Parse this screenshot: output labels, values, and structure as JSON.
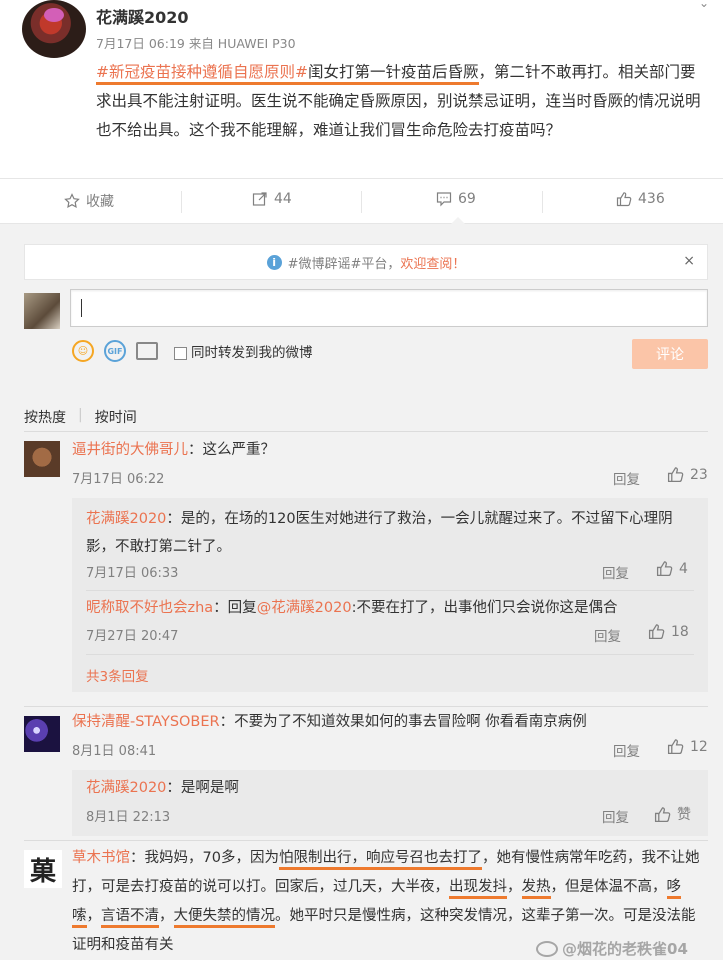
{
  "post": {
    "author": "花满蹊2020",
    "meta": "7月17日 06:19 来自 HUAWEI P30",
    "hashtag": "#新冠疫苗接种遵循自愿原则#",
    "text_underlined": "闺女打第一针疫苗后昏厥",
    "text_rest_1": "，第二针不敢再打。相关部门要求出具不能注射证明。医生说不能确定昏厥原因，别说禁忌证明，连当时昏厥的情况说明也不给出具。这个我不能理解，难道让我们冒生命危险去打疫苗吗？"
  },
  "actions": {
    "favorite": "收藏",
    "forward": "44",
    "comment": "69",
    "like": "436"
  },
  "notice": {
    "hashtag": "#微博辟谣#平台，",
    "welcome": "欢迎查阅！",
    "close": "×"
  },
  "composer": {
    "also_forward": "同时转发到我的微博",
    "submit": "评论",
    "gif": "GIF"
  },
  "sort": {
    "hot": "按热度",
    "time": "按时间"
  },
  "comments": [
    {
      "name": "逼井街的大佛哥儿",
      "text": "：这么严重？",
      "time": "7月17日 06:22",
      "reply": "回复",
      "likes": "23",
      "subreplies": [
        {
          "name": "花满蹊2020",
          "text": "：是的，在场的120医生对她进行了救治，一会儿就醒过来了。不过留下心理阴影，不敢打第二针了。",
          "time": "7月17日 06:33",
          "reply": "回复",
          "likes": "4"
        },
        {
          "name": "昵称取不好也会zha",
          "text_pre": "：回复",
          "mention": "@花满蹊2020",
          "text": ":不要在打了，出事他们只会说你这是偶合",
          "time": "7月27日 20:47",
          "reply": "回复",
          "likes": "18"
        }
      ],
      "more": "共3条回复"
    },
    {
      "name": "保持清醒-STAYSOBER",
      "text": "：不要为了不知道效果如何的事去冒险啊 你看看南京病例",
      "time": "8月1日 08:41",
      "reply": "回复",
      "likes": "12",
      "subreplies": [
        {
          "name": "花满蹊2020",
          "text": "：是啊是啊",
          "time": "8月1日 22:13",
          "reply": "回复",
          "likes": "赞"
        }
      ]
    },
    {
      "name": "草木书馆",
      "avatar_char": "菓",
      "line1_a": "：我妈妈，70多，因为",
      "line1_u": "怕限制出行，响应号召也去打了",
      "line1_b": "，她有慢性病常年吃药，我不让她",
      "line2_a": "打，可是去打疫苗的说可以打。回家后，过几天，大半夜，",
      "line2_u1": "出现发抖",
      "line2_b": "，",
      "line2_u2": "发热",
      "line2_c": "，但是体温不高，",
      "line2_u3": "哆",
      "line3_u1": "嗦",
      "line3_a": "，",
      "line3_u2": "言语不清",
      "line3_b": "，",
      "line3_u3": "大便失禁的情况",
      "line3_c": "。她平时只是慢性病，这种突发情况，这辈子第一次。可是没法能",
      "line4": "证明和疫苗有关"
    }
  ],
  "watermark": "@烟花的老秩雀04",
  "colors": {
    "accent": "#eb7350",
    "underline": "#ee7a2e",
    "submit_bg": "#fbc5a8",
    "page_bg": "#f2f2f2"
  }
}
